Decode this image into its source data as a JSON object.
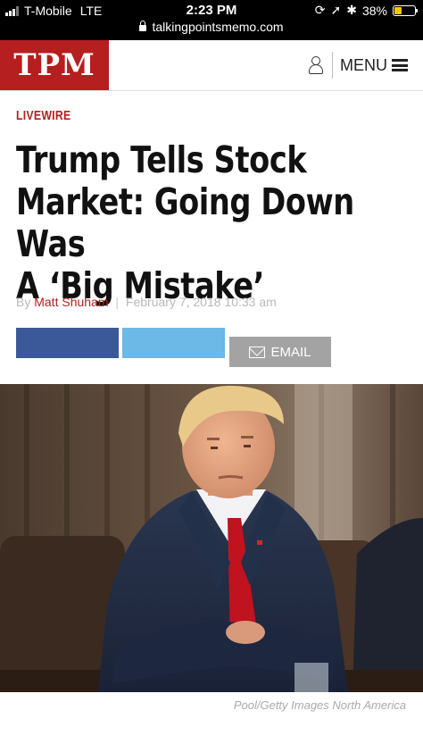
{
  "status_bar": {
    "carrier": "T-Mobile",
    "network": "LTE",
    "time": "2:23 PM",
    "battery": "38%",
    "battery_level": 0.38,
    "url": "talkingpointsmemo.com"
  },
  "header": {
    "logo": "TPM",
    "menu_label": "MENU",
    "accent_color": "#b51f1f"
  },
  "article": {
    "kicker": "LIVEWIRE",
    "headline_lines": [
      "Trump Tells Stock",
      "Market: Going Down Was",
      "A ‘Big Mistake’"
    ],
    "byline_prefix": "By",
    "author": "Matt Shuham",
    "byline_separator": "|",
    "date": "February 7, 2018 10:33 am",
    "share": {
      "email_label": "EMAIL",
      "facebook_color": "#3b5998",
      "twitter_color": "#6cb8e6"
    },
    "photo_caption": "Pool/Getty Images North America"
  },
  "icons": {
    "user": "user-icon",
    "menu": "hamburger-icon",
    "email": "mail-icon",
    "lock": "lock-icon",
    "signal": "signal-icon",
    "battery": "battery-icon"
  }
}
